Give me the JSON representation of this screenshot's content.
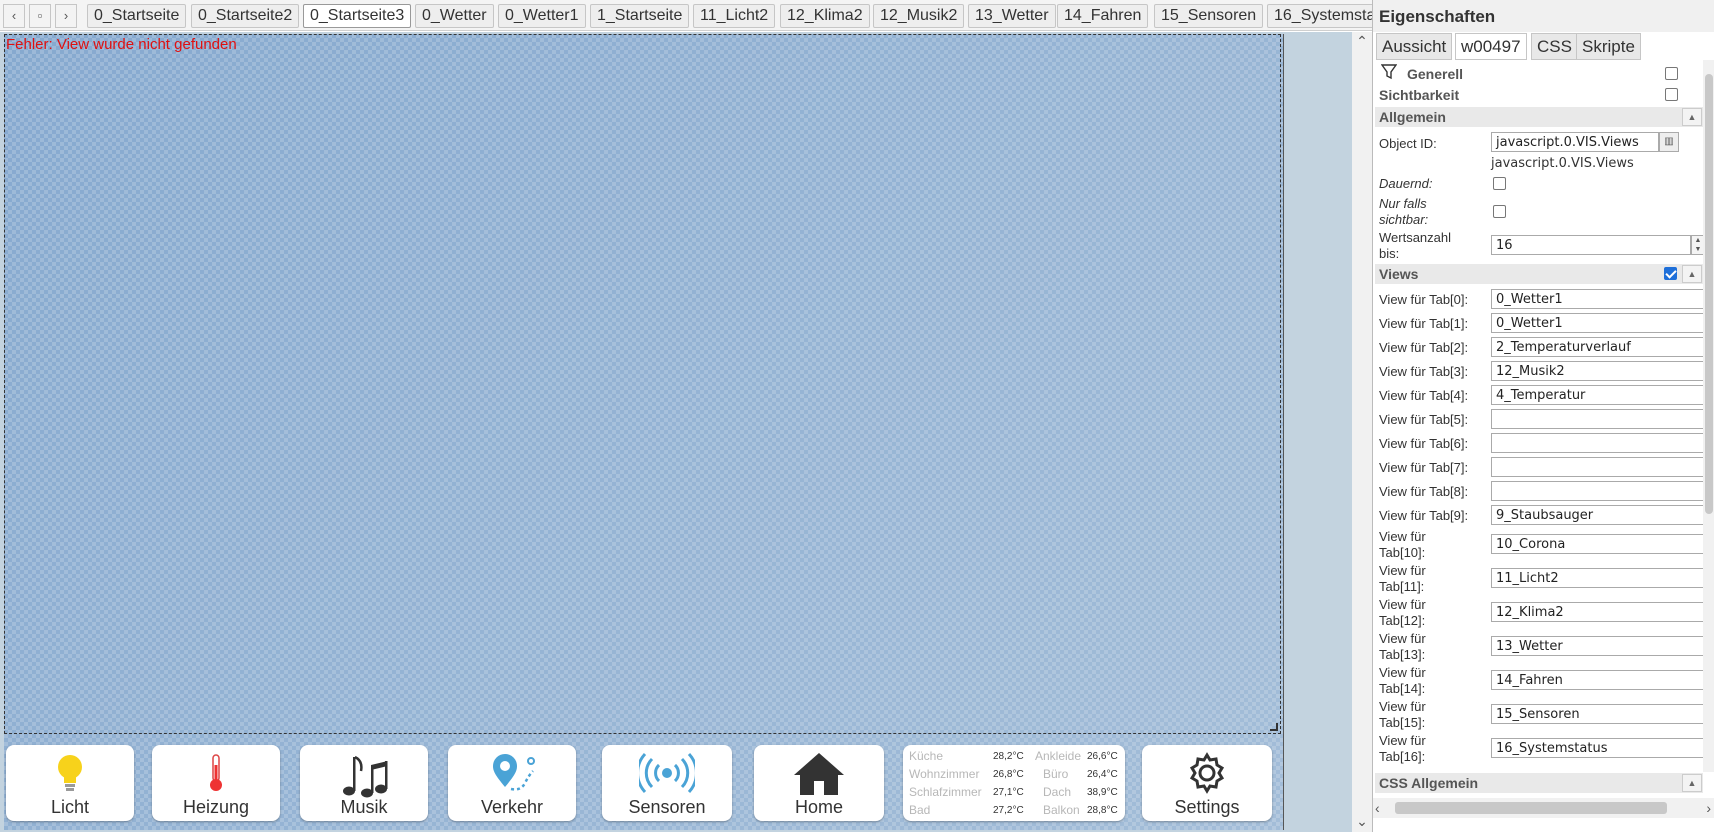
{
  "tabbar": {
    "prev": "‹",
    "menu": "▫",
    "next": "›",
    "tabs": [
      "0_Startseite",
      "0_Startseite2",
      "0_Startseite3",
      "0_Wetter",
      "0_Wetter1",
      "1_Startseite",
      "11_Licht2",
      "12_Klima2",
      "12_Musik2",
      "13_Wetter",
      "14_Fahren",
      "15_Sensoren",
      "16_Systemsta"
    ],
    "active_index": 2
  },
  "canvas": {
    "error": "Fehler: View wurde nicht gefunden"
  },
  "nav": {
    "licht": "Licht",
    "heizung": "Heizung",
    "musik": "Musik",
    "verkehr": "Verkehr",
    "sensoren": "Sensoren",
    "home": "Home",
    "settings": "Settings"
  },
  "temps": [
    {
      "room1": "Küche",
      "val1": "28,2°C",
      "room2": "Ankleide",
      "val2": "26,6°C"
    },
    {
      "room1": "Wohnzimmer",
      "val1": "26,8°C",
      "room2": "Büro",
      "val2": "26,4°C"
    },
    {
      "room1": "Schlafzimmer",
      "val1": "27,1°C",
      "room2": "Dach",
      "val2": "38,9°C"
    },
    {
      "room1": "Bad",
      "val1": "27,2°C",
      "room2": "Balkon",
      "val2": "28,8°C"
    }
  ],
  "panel": {
    "title": "Eigenschaften",
    "tabs": [
      "Aussicht",
      "w00497",
      "CSS",
      "Skripte"
    ],
    "groups": {
      "generell": "Generell",
      "sichtbarkeit": "Sichtbarkeit",
      "allgemein": "Allgemein",
      "views": "Views",
      "css_allgemein": "CSS Allgemein"
    },
    "object_id_label": "Object ID:",
    "object_id": "javascript.0.VIS.Views",
    "object_id_sub": "javascript.0.VIS.Views",
    "dauernd": "Dauernd:",
    "nur_falls_1": "Nur falls",
    "nur_falls_2": "sichtbar:",
    "werts_1": "Wertsanzahl",
    "werts_2": "bis:",
    "werts_value": "16",
    "views_checked": true,
    "view_rows": [
      {
        "label": "View für Tab[0]:",
        "value": "0_Wetter1"
      },
      {
        "label": "View für Tab[1]:",
        "value": "0_Wetter1"
      },
      {
        "label": "View für Tab[2]:",
        "value": "2_Temperaturverlauf"
      },
      {
        "label": "View für Tab[3]:",
        "value": "12_Musik2"
      },
      {
        "label": "View für Tab[4]:",
        "value": "4_Temperatur"
      },
      {
        "label": "View für Tab[5]:",
        "value": ""
      },
      {
        "label": "View für Tab[6]:",
        "value": ""
      },
      {
        "label": "View für Tab[7]:",
        "value": ""
      },
      {
        "label": "View für Tab[8]:",
        "value": ""
      },
      {
        "label": "View für Tab[9]:",
        "value": "9_Staubsauger"
      }
    ],
    "view_rows2": [
      {
        "l1": "View für",
        "l2": "Tab[10]:",
        "value": "10_Corona"
      },
      {
        "l1": "View für",
        "l2": "Tab[11]:",
        "value": "11_Licht2"
      },
      {
        "l1": "View für",
        "l2": "Tab[12]:",
        "value": "12_Klima2"
      },
      {
        "l1": "View für",
        "l2": "Tab[13]:",
        "value": "13_Wetter"
      },
      {
        "l1": "View für",
        "l2": "Tab[14]:",
        "value": "14_Fahren"
      },
      {
        "l1": "View für",
        "l2": "Tab[15]:",
        "value": "15_Sensoren"
      },
      {
        "l1": "View für",
        "l2": "Tab[16]:",
        "value": "16_Systemstatus"
      }
    ]
  }
}
